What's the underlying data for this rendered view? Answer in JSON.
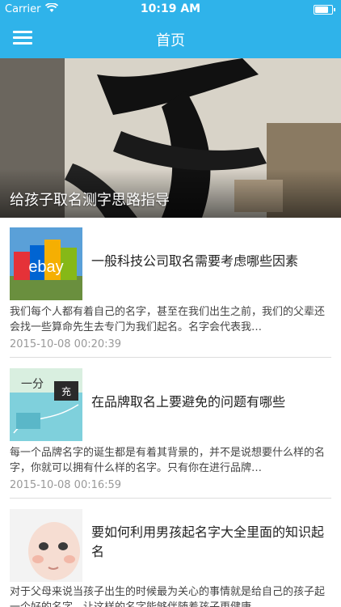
{
  "status": {
    "carrier": "Carrier",
    "time": "10:19 AM",
    "battery_level": 0.9
  },
  "header": {
    "title": "首页",
    "menu_icon": "hamburger-menu-icon"
  },
  "hero": {
    "caption": "给孩子取名测字思路指导"
  },
  "articles": [
    {
      "title": "一般科技公司取名需要考虑哪些因素",
      "summary": "我们每个人都有着自己的名字，甚至在我们出生之前，我们的父辈还会找一些算命先生去专门为我们起名。名字会代表我…",
      "date": "2015-10-08 00:20:39",
      "thumb_text": "ebay"
    },
    {
      "title": "在品牌取名上要避免的问题有哪些",
      "summary": "每一个品牌名字的诞生都是有着其背景的，并不是说想要什么样的名字，你就可以拥有什么样的名字。只有你在进行品牌…",
      "date": "2015-10-08 00:16:59",
      "thumb_text": "一分"
    },
    {
      "title": "要如何利用男孩起名字大全里面的知识起名",
      "summary": "对于父母来说当孩子出生的时候最为关心的事情就是给自己的孩子起一个好的名字，让这样的名字能够伴随着孩子更健康",
      "date": "",
      "thumb_text": ""
    }
  ],
  "colors": {
    "header": "#2fb3ea",
    "date": "#999999"
  }
}
